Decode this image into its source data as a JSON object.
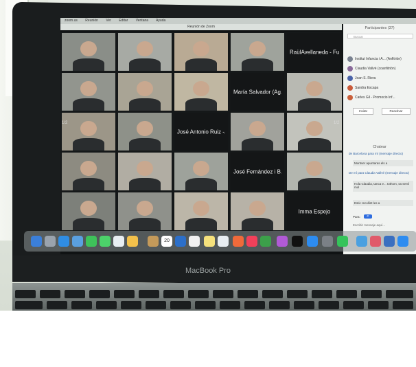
{
  "photo": {
    "menubar_items": [
      "zoom.us",
      "Reunión",
      "Ver",
      "Editar",
      "Ventana",
      "Ayuda"
    ],
    "window_title": "Reunión de Zoom",
    "participant_labels": [
      "RaülAvellaneda - Fu...",
      "María Salvador (Ag...",
      "José Antonio Ruiz -...",
      "José Fernández i B...",
      "Imma Espejo"
    ],
    "page_indicator_left": "1/2",
    "page_indicator_right": "1/2",
    "sidebar": {
      "participants_title": "Participantes (37)",
      "search_placeholder": "Buscar",
      "rows": [
        "Institut Infancia i A... (Anfitrión)",
        "Claudia Vallvé (coanfitrión)",
        "Joan S. Riera",
        "Sandra Escapa",
        "Carles Gil - Promocio Inf..."
      ],
      "invite_label": "Invitar",
      "mute_label": "Reactivar",
      "chat_title": "Chatear",
      "chat_lines": [
        "de Barcelona para mí (mensaje directo)",
        "Montser apuntaras els a",
        "De mí para Claudia Vallvé (mensaje directo)",
        "Hola Claudia, tanca e... tothom, sa sentí mol",
        "Estic recollint les a"
      ],
      "to_label": "Para:",
      "to_value": "C",
      "message_placeholder": "Escribir mensaje aquí..."
    },
    "dock_date": "20",
    "brand": "MacBook Pro"
  }
}
